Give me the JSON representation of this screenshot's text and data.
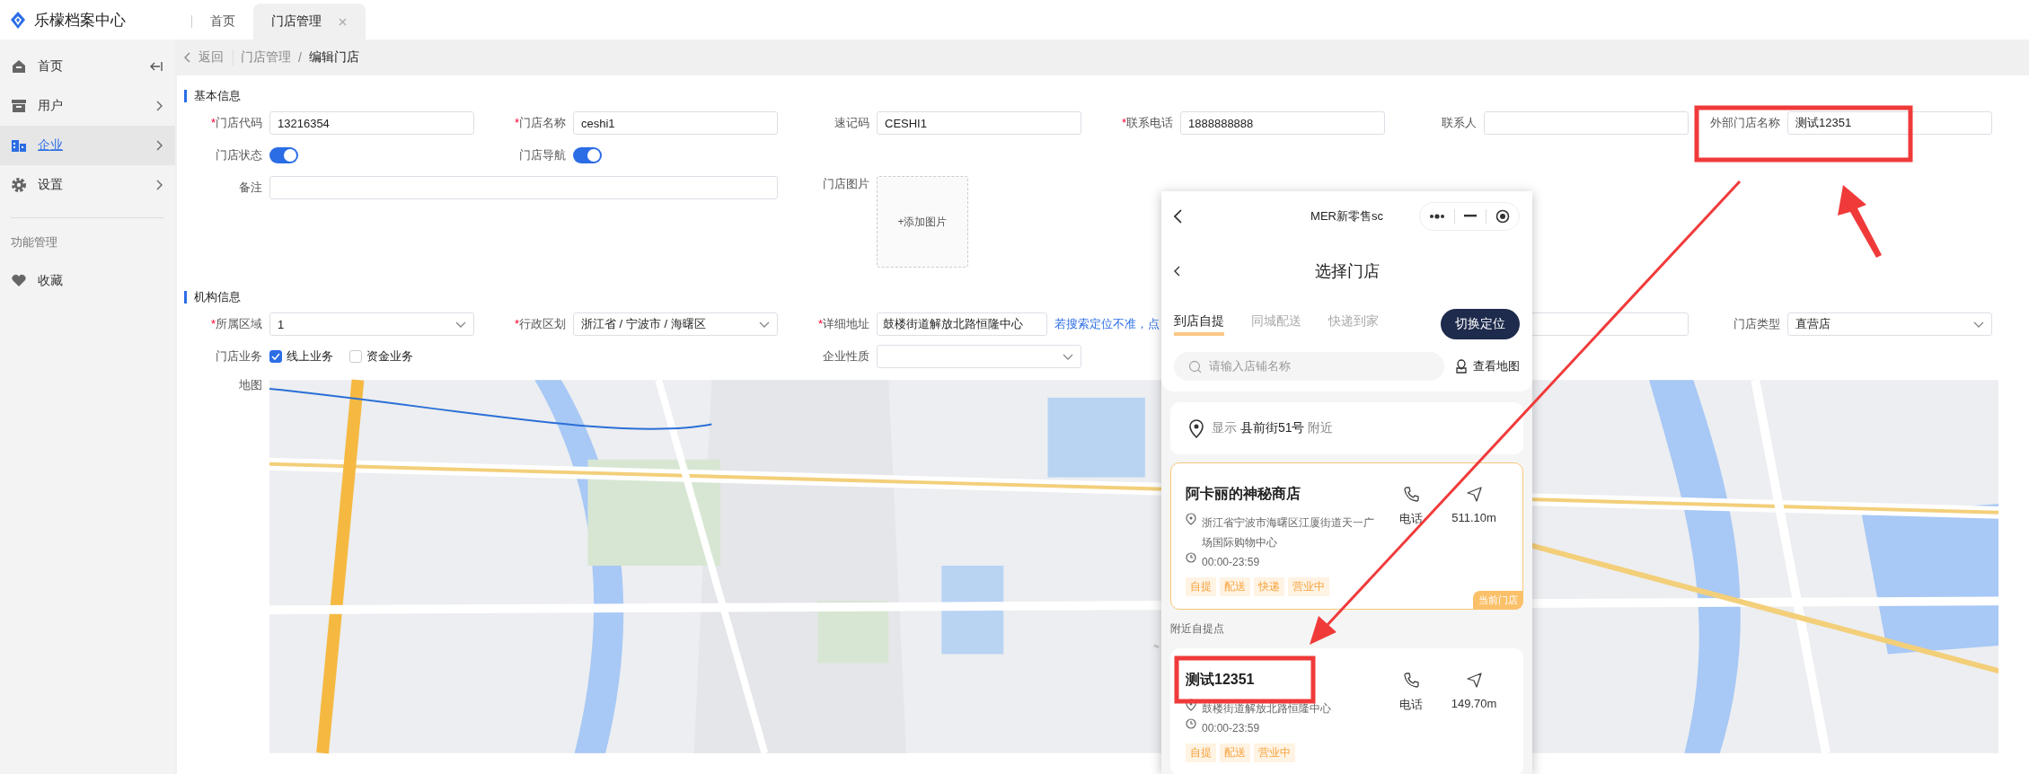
{
  "app": {
    "title": "乐檬档案中心"
  },
  "tabs": [
    {
      "label": "首页",
      "selected": false,
      "closable": false
    },
    {
      "label": "门店管理",
      "selected": true,
      "closable": true
    }
  ],
  "sidebar": {
    "items": [
      {
        "label": "首页",
        "selected": false,
        "expandable": false
      },
      {
        "label": "用户",
        "selected": false,
        "expandable": true
      },
      {
        "label": "企业",
        "selected": true,
        "expandable": true
      },
      {
        "label": "设置",
        "selected": false,
        "expandable": true
      }
    ],
    "group_label": "功能管理",
    "group_items": [
      {
        "label": "收藏",
        "selected": false
      }
    ]
  },
  "breadcrumb": {
    "back": "返回",
    "path": [
      "门店管理",
      "编辑门店"
    ],
    "separator": "/"
  },
  "basic_info": {
    "title": "基本信息",
    "rows": [
      [
        {
          "kind": "input",
          "mark": "*",
          "label": "门店代码",
          "value": "13216354"
        },
        {
          "kind": "input",
          "mark": "*",
          "label": "门店名称",
          "value": "ceshi1"
        },
        {
          "kind": "input",
          "label": "速记码",
          "value": "CESHI1"
        },
        {
          "kind": "input",
          "mark": "*",
          "label": "联系电话",
          "value": "1888888888"
        },
        {
          "kind": "input",
          "label": "联系人"
        },
        {
          "kind": "input",
          "label": "外部门店名称",
          "value": "测试12351"
        }
      ],
      [
        {
          "kind": "switch",
          "label": "门店状态",
          "on": true
        },
        {
          "kind": "switch",
          "label": "门店导航",
          "on": true
        }
      ],
      [
        {
          "kind": "wide",
          "label": "备注"
        },
        "",
        {
          "kind": "upload",
          "label": "门店图片",
          "text": "+添加图片"
        }
      ]
    ]
  },
  "org_info": {
    "title": "机构信息",
    "rows": [
      [
        {
          "kind": "select",
          "mark": "*",
          "label": "所属区域",
          "value": "1"
        },
        {
          "kind": "select",
          "mark": "*",
          "label": "行政区划",
          "value": "浙江省 / 宁波市 / 海曙区"
        },
        {
          "kind": "address",
          "mark": "*",
          "label": "详细地址",
          "value": "鼓楼街道解放北路恒隆中心",
          "link": "若搜索定位不准，点"
        },
        "",
        {
          "kind": "input"
        },
        {
          "kind": "select",
          "label": "门店类型",
          "value": "直营店"
        }
      ],
      [
        {
          "kind": "checkboxes",
          "label": "门店业务",
          "options": [
            {
              "label": "线上业务",
              "checked": true
            },
            {
              "label": "资金业务",
              "checked": false
            }
          ]
        },
        "",
        {
          "kind": "select",
          "label": "企业性质"
        }
      ],
      [
        {
          "kind": "map",
          "label": "地图"
        }
      ]
    ]
  },
  "mini_program": {
    "title": "MER新零售sc",
    "page_title": "选择门店",
    "tabs": [
      {
        "label": "到店自提",
        "selected": true
      },
      {
        "label": "同城配送",
        "selected": false
      },
      {
        "label": "快递到家",
        "selected": false
      }
    ],
    "switch_button": "切换定位",
    "search_placeholder": "请输入店铺名称",
    "map_link": "查看地图",
    "location": {
      "prefix": "显示",
      "address": "县前街51号",
      "suffix": "附近"
    },
    "nearby_label": "附近自提点",
    "stores": [
      {
        "name": "阿卡丽的神秘商店",
        "address": "浙江省宁波市海曙区江厦街道天一广场国际购物中心",
        "hours": "00:00-23:59",
        "phone_label": "电话",
        "distance": "511.10m",
        "tags": [
          "自提",
          "配送",
          "快递",
          "营业中"
        ],
        "current": true,
        "badge": "当前门店"
      },
      {
        "name": "测试12351",
        "address": "鼓楼街道解放北路恒隆中心",
        "hours": "00:00-23:59",
        "phone_label": "电话",
        "distance": "149.70m",
        "tags": [
          "自提",
          "配送",
          "营业中"
        ],
        "current": false
      }
    ]
  }
}
